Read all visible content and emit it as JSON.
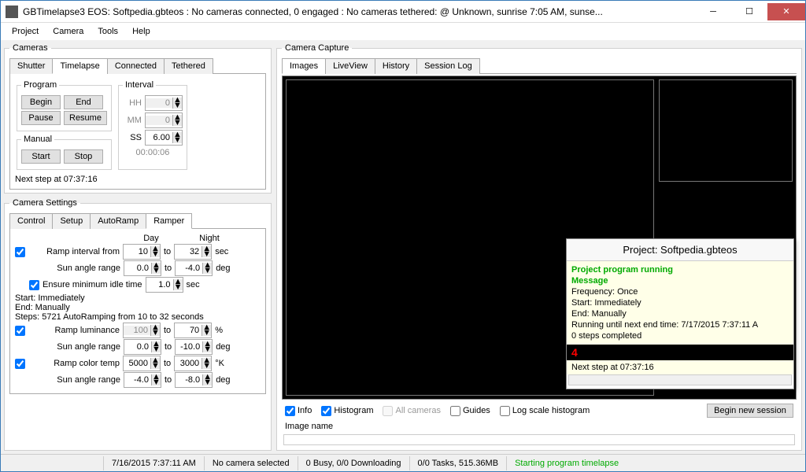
{
  "title": "GBTimelapse3 EOS: Softpedia.gbteos : No cameras connected, 0 engaged : No cameras tethered: @ Unknown, sunrise 7:05 AM, sunse...",
  "menu": [
    "Project",
    "Camera",
    "Tools",
    "Help"
  ],
  "cameras": {
    "legend": "Cameras",
    "tabs": [
      "Shutter",
      "Timelapse",
      "Connected",
      "Tethered"
    ],
    "program": {
      "legend": "Program",
      "begin": "Begin",
      "end": "End",
      "pause": "Pause",
      "resume": "Resume"
    },
    "manual": {
      "legend": "Manual",
      "start": "Start",
      "stop": "Stop"
    },
    "interval": {
      "legend": "Interval",
      "hh": "HH",
      "hh_v": "0",
      "mm": "MM",
      "mm_v": "0",
      "ss": "SS",
      "ss_v": "6.00",
      "readout": "00:00:06"
    },
    "nextstep": "Next step at 07:37:16"
  },
  "settings": {
    "legend": "Camera Settings",
    "tabs": [
      "Control",
      "Setup",
      "AutoRamp",
      "Ramper"
    ],
    "hdr_day": "Day",
    "hdr_night": "Night",
    "ramp_interval_lbl": "Ramp interval from",
    "ramp_interval_day": "10",
    "ramp_interval_night": "32",
    "unit_sec": "sec",
    "sun_angle_lbl": "Sun angle range",
    "sun_angle_day": "0.0",
    "sun_angle_night": "-4.0",
    "unit_deg": "deg",
    "ensure_idle_lbl": "Ensure minimum idle time",
    "ensure_idle_v": "1.0",
    "start_line": "Start:  Immediately",
    "end_line": "End:  Manually",
    "steps_line": "Steps: 5721 AutoRamping from 10 to 32 seconds",
    "ramp_lum_lbl": "Ramp luminance",
    "ramp_lum_day": "100",
    "ramp_lum_night": "70",
    "unit_pct": "%",
    "lum_sun_day": "0.0",
    "lum_sun_night": "-10.0",
    "ramp_ct_lbl": "Ramp color temp",
    "ramp_ct_day": "5000",
    "ramp_ct_night": "3000",
    "unit_k": "°K",
    "ct_sun_day": "-4.0",
    "ct_sun_night": "-8.0"
  },
  "capture": {
    "legend": "Camera Capture",
    "tabs": [
      "Images",
      "LiveView",
      "History",
      "Session Log"
    ],
    "info": "Info",
    "histogram": "Histogram",
    "allcam": "All cameras",
    "guides": "Guides",
    "logscale": "Log scale histogram",
    "begin_session": "Begin new session",
    "image_name": "Image name"
  },
  "popup": {
    "title": "Project: Softpedia.gbteos",
    "l1": "Project program running",
    "l2": "Message",
    "l3": "Frequency: Once",
    "l4": "Start:  Immediately",
    "l5": "End:   Manually",
    "l6": "Running until next end time: 7/17/2015 7:37:11 A",
    "l7": "0 steps completed",
    "count": "4",
    "foot": "Next step at 07:37:16"
  },
  "status": {
    "s1": "7/16/2015 7:37:11 AM",
    "s2": "No camera selected",
    "s3": "0 Busy, 0/0 Downloading",
    "s4": "0/0 Tasks, 515.36MB",
    "s5": "Starting program timelapse"
  }
}
